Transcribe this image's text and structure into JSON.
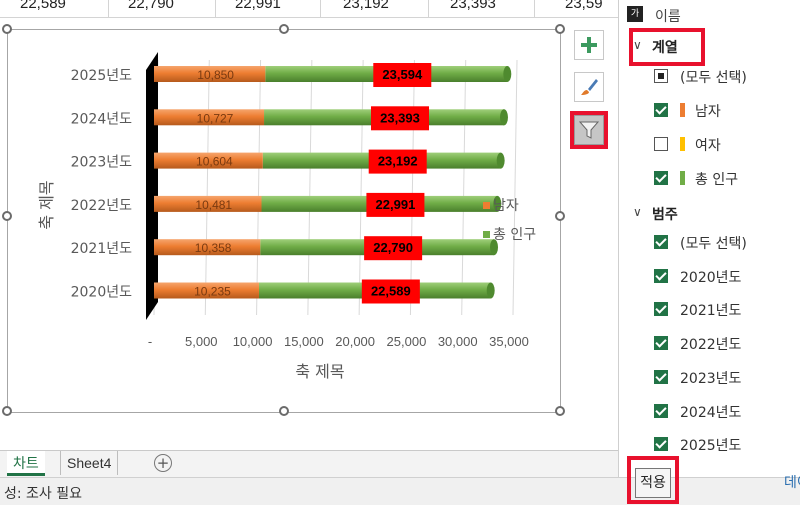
{
  "top_row": {
    "cells": [
      "22,589",
      "22,790",
      "22,991",
      "23,192",
      "23,393",
      "23,59"
    ]
  },
  "chart_data": {
    "type": "bar",
    "orientation": "horizontal",
    "stacked": true,
    "categories": [
      "2020년도",
      "2021년도",
      "2022년도",
      "2023년도",
      "2024년도",
      "2025년도"
    ],
    "series": [
      {
        "name": "남자",
        "values": [
          10235,
          10358,
          10481,
          10604,
          10727,
          10850
        ],
        "labels": [
          "10,235",
          "10,358",
          "10,481",
          "10,604",
          "10,727",
          "10,850"
        ]
      },
      {
        "name": "총 인구",
        "values": [
          22589,
          22790,
          22991,
          23192,
          23393,
          23594
        ],
        "labels": [
          "22,589",
          "22,790",
          "22,991",
          "23,192",
          "23,393",
          "23,594"
        ]
      }
    ],
    "x_ticks": [
      "-",
      "5,000",
      "10,000",
      "15,000",
      "20,000",
      "25,000",
      "30,000",
      "35,000"
    ],
    "xlim": [
      0,
      35000
    ],
    "xlabel": "축 제목",
    "ylabel": "축 제목",
    "legend_position": "right",
    "colors": {
      "남자": "#ed7d31",
      "총 인구": "#70ad47",
      "label_box": "#ff0000",
      "wall": "#000000"
    }
  },
  "chart_tools": {
    "add_element": "chart-elements",
    "style": "chart-styles",
    "filter": "chart-filters"
  },
  "sheet_tabs": {
    "tabs": [
      "차트",
      "Sheet4"
    ],
    "active": "차트"
  },
  "status_bar": {
    "text": "성: 조사 필요"
  },
  "filter_pane": {
    "header_label": "이름",
    "series_section": "계열",
    "series_items": [
      {
        "label": "(모두 선택)",
        "state": "partial"
      },
      {
        "label": "남자",
        "state": "checked",
        "color": "#ed7d31"
      },
      {
        "label": "여자",
        "state": "unchecked",
        "color": "#ffc000"
      },
      {
        "label": "총 인구",
        "state": "checked",
        "color": "#70ad47"
      }
    ],
    "category_section": "범주",
    "category_items": [
      {
        "label": "(모두 선택)",
        "state": "checked"
      },
      {
        "label": "2020년도",
        "state": "checked"
      },
      {
        "label": "2021년도",
        "state": "checked"
      },
      {
        "label": "2022년도",
        "state": "checked"
      },
      {
        "label": "2023년도",
        "state": "checked"
      },
      {
        "label": "2024년도",
        "state": "checked"
      },
      {
        "label": "2025년도",
        "state": "checked"
      }
    ],
    "apply_button": "적용",
    "data_link": "데이"
  }
}
